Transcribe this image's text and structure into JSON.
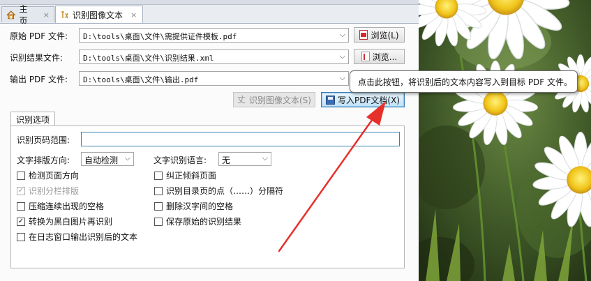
{
  "tabs": [
    {
      "label": "主页",
      "icon": "home-icon"
    },
    {
      "label": "识别图像文本",
      "icon": "ocr-document-icon"
    }
  ],
  "files": {
    "source_label": "原始 PDF 文件:",
    "source_value": "D:\\tools\\桌面\\文件\\需提供证件模板.pdf",
    "result_label": "识别结果文件:",
    "result_value": "D:\\tools\\桌面\\文件\\识别结果.xml",
    "output_label": "输出 PDF 文件:",
    "output_value": "D:\\tools\\桌面\\文件\\输出.pdf"
  },
  "buttons": {
    "browse_pdf": "浏览(L)",
    "browse_result": "浏览...",
    "recognize": "识别图像文本(S)",
    "write_pdf": "写入PDF文档(X)"
  },
  "tooltip": "点击此按钮，将识别后的文本内容写入到目标 PDF 文件。",
  "options": {
    "group_title": "识别选项",
    "page_range_label": "识别页码范围:",
    "page_range_value": "",
    "direction_label": "文字排版方向:",
    "direction_value": "自动检测",
    "language_label": "文字识别语言:",
    "language_value": "无",
    "checkboxes": [
      {
        "label": "检测页面方向",
        "checked": false,
        "disabled": false
      },
      {
        "label": "纠正倾斜页面",
        "checked": false,
        "disabled": false
      },
      {
        "label": "识别分栏排版",
        "checked": true,
        "disabled": true
      },
      {
        "label": "识别目录页的点（……）分隔符",
        "checked": false,
        "disabled": false
      },
      {
        "label": "压缩连续出现的空格",
        "checked": false,
        "disabled": false
      },
      {
        "label": "删除汉字间的空格",
        "checked": false,
        "disabled": false
      },
      {
        "label": "转换为黑白图片再识别",
        "checked": true,
        "disabled": false
      },
      {
        "label": "保存原始的识别结果",
        "checked": false,
        "disabled": false
      },
      {
        "label": "在日志窗口输出识别后的文本",
        "checked": false,
        "disabled": false
      }
    ]
  },
  "glyphs": {
    "close": "×",
    "dropdown": "⌵",
    "check": "✓"
  },
  "colors": {
    "accent": "#3c7fb1",
    "arrow": "#e8302a",
    "tooltip_border": "#6b6b6b"
  }
}
